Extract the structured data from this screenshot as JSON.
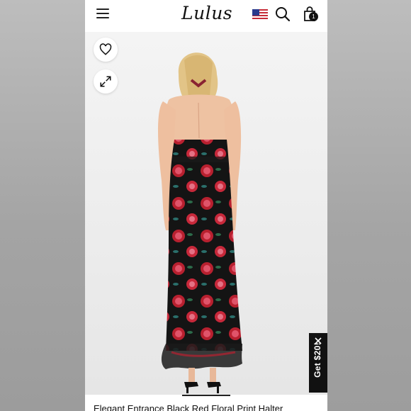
{
  "header": {
    "logo_text": "Lulus",
    "icons": [
      "menu-icon",
      "us-flag-icon",
      "search-icon",
      "shopping-bag-icon"
    ],
    "cart_count": "1"
  },
  "product": {
    "title": "Elegant Entrance Black Red Floral Print Halter",
    "image_actions": [
      "heart-icon",
      "expand-icon"
    ]
  },
  "promo": {
    "label": "Get $20!",
    "close_icon": "close-icon"
  },
  "colors": {
    "header_bg": "#ffffff",
    "promo_bg": "#111111",
    "dress_base": "#141414",
    "rose": "#c8283a"
  }
}
